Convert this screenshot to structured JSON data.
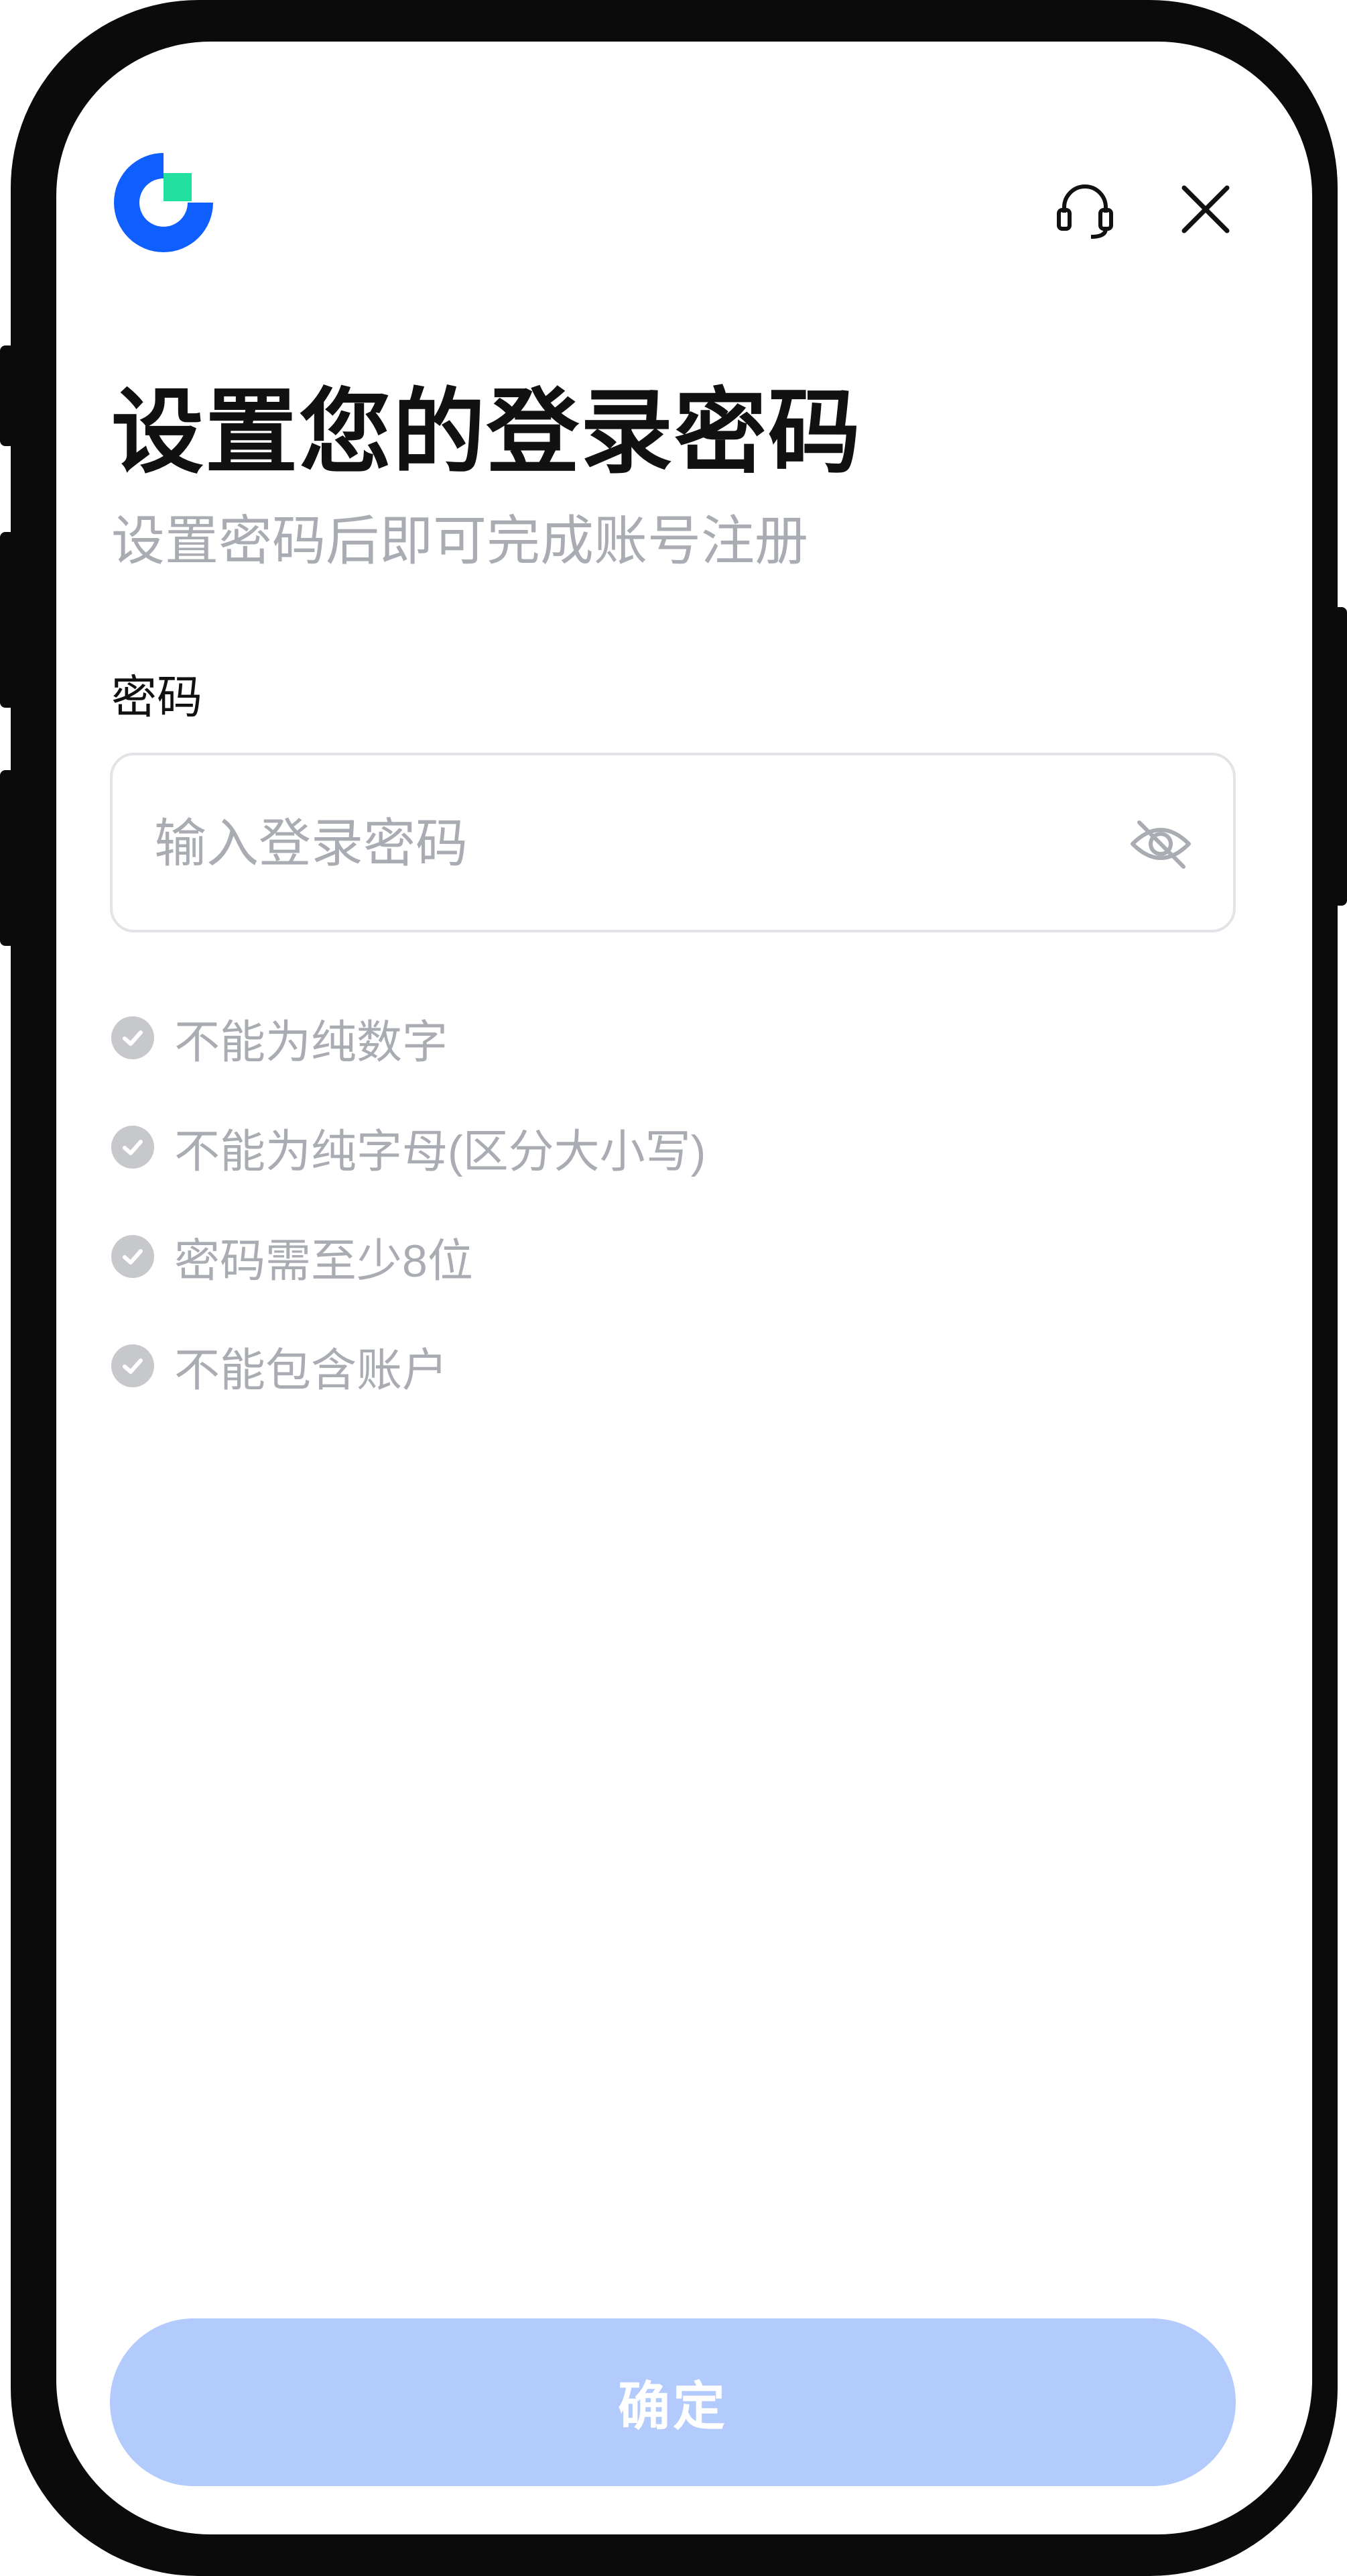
{
  "header": {
    "logo_icon": "app-logo-icon",
    "support_icon": "headset-icon",
    "close_icon": "close-icon"
  },
  "title": "设置您的登录密码",
  "subtitle": "设置密码后即可完成账号注册",
  "password_field": {
    "label": "密码",
    "placeholder": "输入登录密码",
    "value": "",
    "toggle_icon": "eye-off-icon"
  },
  "rules": [
    {
      "text": "不能为纯数字",
      "icon": "check-circle-icon"
    },
    {
      "text": "不能为纯字母(区分大小写)",
      "icon": "check-circle-icon"
    },
    {
      "text": "密码需至少8位",
      "icon": "check-circle-icon"
    },
    {
      "text": "不能包含账户",
      "icon": "check-circle-icon"
    }
  ],
  "confirm_button": {
    "label": "确定"
  },
  "colors": {
    "brand_blue": "#0f5eff",
    "brand_green": "#22e0a0",
    "button_disabled": "#b3cafd",
    "muted_text": "#a9acb3",
    "check_gray": "#c6c8cc"
  }
}
